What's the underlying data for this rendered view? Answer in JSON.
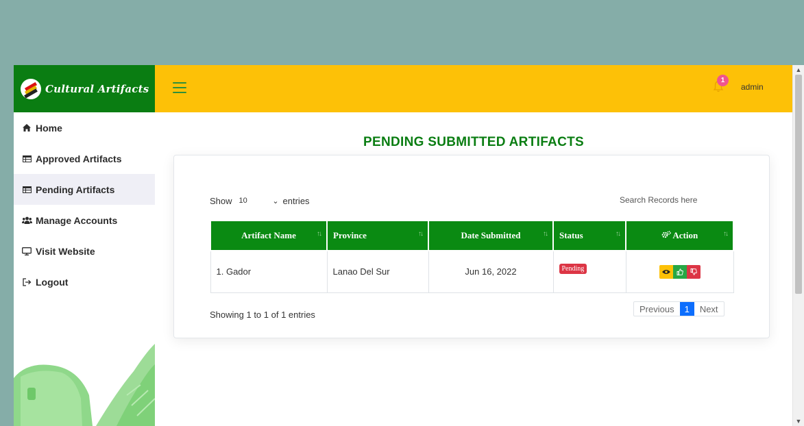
{
  "brand": {
    "title": "Cultural Artifacts"
  },
  "topbar": {
    "notification_count": "1",
    "user": "admin"
  },
  "sidebar": {
    "items": [
      {
        "label": "Home",
        "icon": "home-icon"
      },
      {
        "label": "Approved Artifacts",
        "icon": "table-icon"
      },
      {
        "label": "Pending Artifacts",
        "icon": "table-icon",
        "active": true
      },
      {
        "label": "Manage Accounts",
        "icon": "users-icon"
      },
      {
        "label": "Visit Website",
        "icon": "desktop-icon"
      },
      {
        "label": "Logout",
        "icon": "logout-icon"
      }
    ]
  },
  "main": {
    "title": "PENDING SUBMITTED ARTIFACTS",
    "show_label": "Show",
    "page_length": "10",
    "entries_label": "entries",
    "search_placeholder": "Search Records here",
    "table": {
      "headers": [
        "Artifact Name",
        "Province",
        "Date Submitted",
        "Status",
        "Action"
      ],
      "rows": [
        {
          "name": "1. Gador",
          "province": "Lanao Del Sur",
          "date": "Jun 16, 2022",
          "status": "Pending"
        }
      ]
    },
    "info": "Showing 1 to 1 of 1 entries",
    "pagination": {
      "previous": "Previous",
      "current": "1",
      "next": "Next"
    }
  },
  "colors": {
    "brand_green": "#0a7d12",
    "topbar_yellow": "#fdc107",
    "page_bg": "#85ada8",
    "danger": "#dc3545",
    "success": "#28a745",
    "primary": "#0d6efd"
  }
}
